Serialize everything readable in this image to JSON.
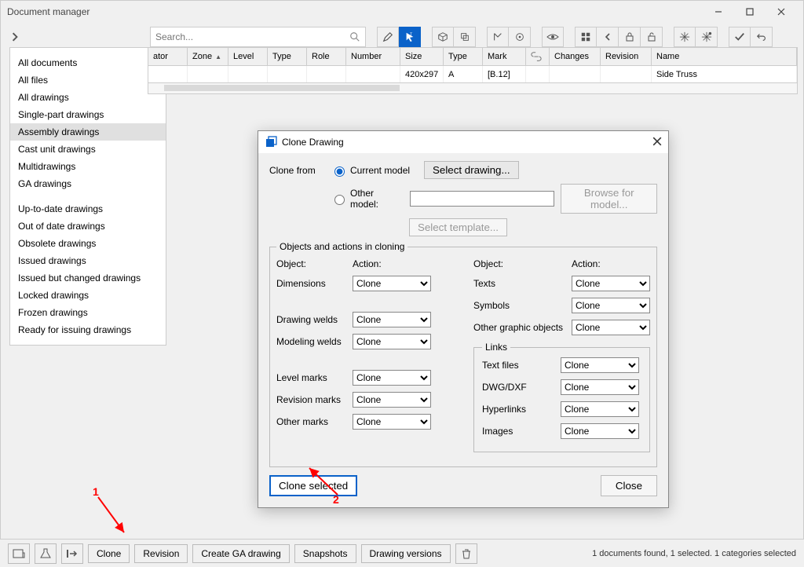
{
  "window": {
    "title": "Document manager"
  },
  "search": {
    "placeholder": "Search..."
  },
  "sidebar": {
    "items": [
      {
        "label": "All documents"
      },
      {
        "label": "All files"
      },
      {
        "label": "All drawings"
      },
      {
        "label": "Single-part drawings"
      },
      {
        "label": "Assembly drawings",
        "selected": true
      },
      {
        "label": "Cast unit drawings"
      },
      {
        "label": "Multidrawings"
      },
      {
        "label": "GA drawings"
      }
    ],
    "items2": [
      {
        "label": "Up-to-date drawings"
      },
      {
        "label": "Out of date drawings"
      },
      {
        "label": "Obsolete drawings"
      },
      {
        "label": "Issued drawings"
      },
      {
        "label": "Issued but changed drawings"
      },
      {
        "label": "Locked drawings"
      },
      {
        "label": "Frozen drawings"
      },
      {
        "label": "Ready for issuing drawings"
      }
    ]
  },
  "grid": {
    "columns": [
      "ator",
      "Zone",
      "Level",
      "Type",
      "Role",
      "Number",
      "Size",
      "Type",
      "Mark",
      "",
      "Changes",
      "Revision",
      "Name"
    ],
    "row": {
      "size": "420x297",
      "type2": "A",
      "mark": "[B.12]",
      "name": "Side Truss"
    }
  },
  "bottom": {
    "buttons": {
      "clone": "Clone",
      "revision": "Revision",
      "ga": "Create GA drawing",
      "snapshots": "Snapshots",
      "versions": "Drawing versions"
    },
    "status": "1 documents found, 1 selected. 1 categories selected"
  },
  "dialog": {
    "title": "Clone Drawing",
    "clone_from_label": "Clone from",
    "radio_current": "Current model",
    "radio_other": "Other model:",
    "select_drawing": "Select drawing...",
    "browse_model": "Browse for model...",
    "select_template": "Select template...",
    "section_label": "Objects and actions in cloning",
    "headers": {
      "object": "Object:",
      "action": "Action:"
    },
    "left": [
      {
        "label": "Dimensions",
        "value": "Clone"
      },
      {
        "label": "Drawing welds",
        "value": "Clone"
      },
      {
        "label": "Modeling welds",
        "value": "Clone"
      },
      {
        "label": "Level marks",
        "value": "Clone"
      },
      {
        "label": "Revision marks",
        "value": "Clone"
      },
      {
        "label": "Other marks",
        "value": "Clone"
      }
    ],
    "right": [
      {
        "label": "Texts",
        "value": "Clone"
      },
      {
        "label": "Symbols",
        "value": "Clone"
      },
      {
        "label": "Other graphic objects",
        "value": "Clone"
      }
    ],
    "links_legend": "Links",
    "links": [
      {
        "label": "Text files",
        "value": "Clone"
      },
      {
        "label": "DWG/DXF",
        "value": "Clone"
      },
      {
        "label": "Hyperlinks",
        "value": "Clone"
      },
      {
        "label": "Images",
        "value": "Clone"
      }
    ],
    "clone_selected": "Clone selected",
    "close": "Close"
  },
  "annotations": {
    "one": "1",
    "two": "2"
  }
}
